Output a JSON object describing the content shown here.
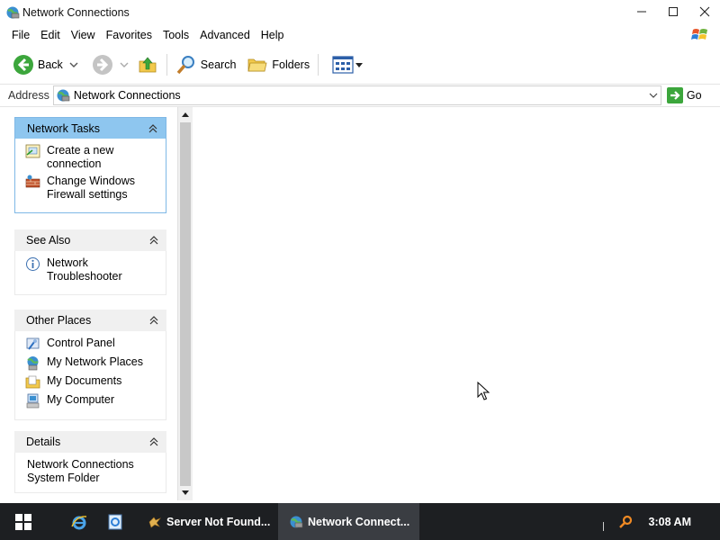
{
  "window": {
    "title": "Network Connections",
    "controls": {
      "minimize": "minimize-icon",
      "maximize": "maximize-icon",
      "close": "close-icon"
    }
  },
  "menubar": {
    "items": [
      "File",
      "Edit",
      "View",
      "Favorites",
      "Tools",
      "Advanced",
      "Help"
    ]
  },
  "toolbar": {
    "back_label": "Back",
    "search_label": "Search",
    "folders_label": "Folders"
  },
  "address": {
    "label": "Address",
    "value": "Network Connections",
    "go_label": "Go"
  },
  "taskpane": {
    "network_tasks": {
      "title": "Network Tasks",
      "items": [
        {
          "label": "Create a new connection",
          "icon": "new-connection-icon"
        },
        {
          "label": "Change Windows Firewall settings",
          "icon": "firewall-icon"
        }
      ]
    },
    "see_also": {
      "title": "See Also",
      "items": [
        {
          "label": "Network Troubleshooter",
          "icon": "info-icon"
        }
      ]
    },
    "other_places": {
      "title": "Other Places",
      "items": [
        {
          "label": "Control Panel",
          "icon": "control-panel-icon"
        },
        {
          "label": "My Network Places",
          "icon": "network-places-icon"
        },
        {
          "label": "My Documents",
          "icon": "documents-icon"
        },
        {
          "label": "My Computer",
          "icon": "computer-icon"
        }
      ]
    },
    "details": {
      "title": "Details",
      "line1": "Network Connections",
      "line2": "System Folder"
    }
  },
  "taskbar": {
    "tasks": [
      {
        "label": "Server Not Found...",
        "active": false
      },
      {
        "label": "Network Connect...",
        "active": true
      }
    ],
    "clock": "3:08 AM"
  },
  "colors": {
    "panel_header_active": "#8ec6ef",
    "panel_header": "#f0f0f0",
    "taskbar": "#1d1f22",
    "taskbar_active": "#3a3d42"
  }
}
